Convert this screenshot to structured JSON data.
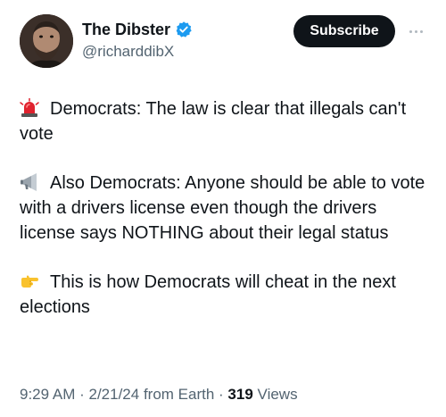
{
  "author": {
    "display_name": "The Dibster",
    "handle": "@richarddibX",
    "verified": true,
    "avatar_icon": "profile-photo"
  },
  "actions": {
    "subscribe_label": "Subscribe",
    "more_icon": "more-horizontal-icon"
  },
  "tweet": {
    "paragraphs": [
      {
        "icon": "rotating-light-icon",
        "text": "Democrats: The law is clear that illegals can't vote"
      },
      {
        "icon": "megaphone-icon",
        "text": "Also Democrats:  Anyone should be able to vote with a drivers license even though the drivers license says NOTHING about their legal status"
      },
      {
        "icon": "backhand-pointing-right-icon",
        "text": "This is how Democrats will cheat in the next elections"
      }
    ]
  },
  "meta": {
    "time": "9:29 AM",
    "date": "2/21/24",
    "source": "from Earth",
    "separator": " · ",
    "views_count": "319",
    "views_label": "Views"
  },
  "colors": {
    "text_primary": "#0f1419",
    "text_secondary": "#536471",
    "verified_blue": "#1d9bf0",
    "button_bg": "#0f1419"
  }
}
